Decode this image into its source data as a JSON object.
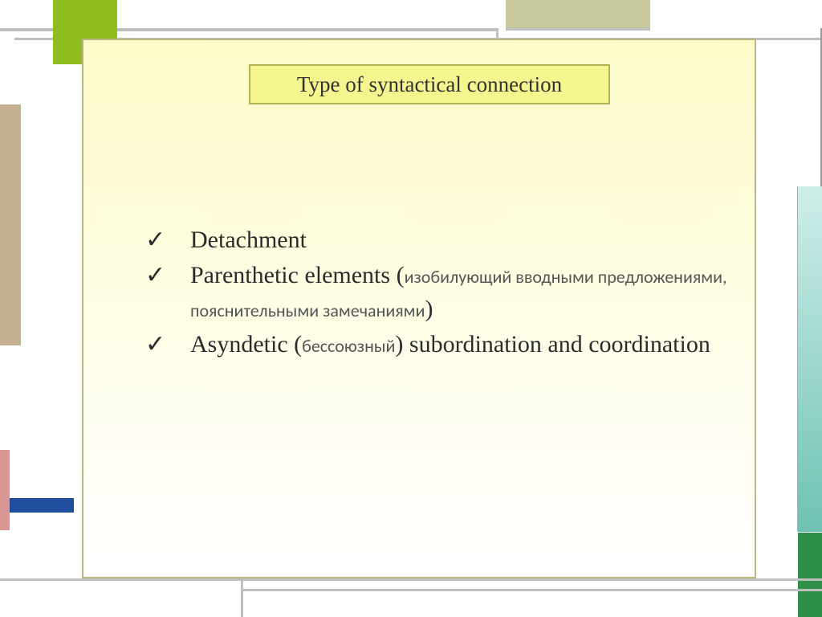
{
  "title": "Type of syntactical connection",
  "checkmark": "✓",
  "items": [
    {
      "main": "Detachment"
    },
    {
      "main": "Parenthetic elements",
      "open": "(",
      "ru": "изобилующий вводными предложениями, пояснительными замечаниями",
      "close": ")"
    },
    {
      "main": "Asyndetic",
      "open": "(",
      "ru": "бессоюзный",
      "close": ")",
      "tail": " subordination and coordination"
    }
  ]
}
